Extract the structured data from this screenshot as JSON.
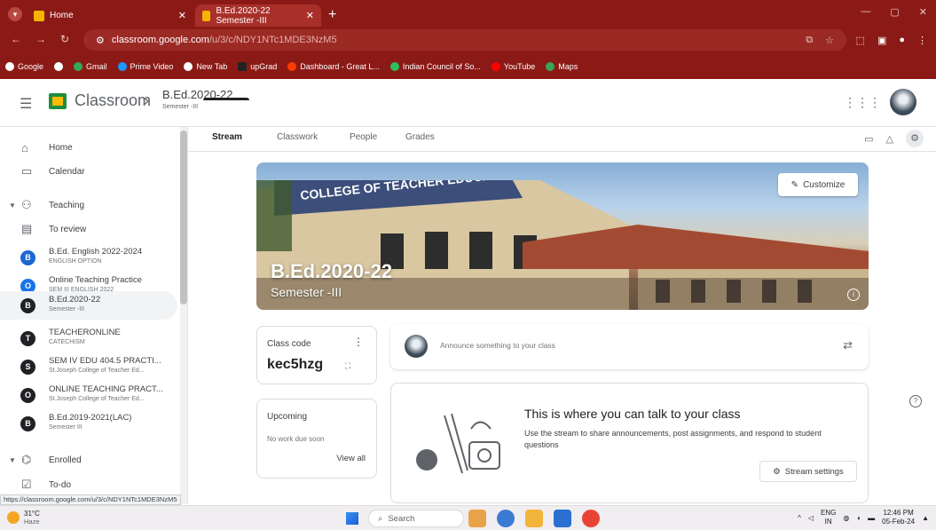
{
  "browser": {
    "tabs": [
      {
        "title": "Home"
      },
      {
        "title": "B.Ed.2020-22 Semester -III"
      }
    ],
    "url_host": "classroom.google.com",
    "url_path": "/u/3/c/NDY1NTc1MDE3NzM5",
    "bookmarks": [
      "Google",
      "Gmail",
      "Prime Video",
      "New Tab",
      "upGrad",
      "Dashboard - Great L...",
      "Indian Council of So...",
      "YouTube",
      "Maps"
    ],
    "status_url": "https://classroom.google.com/u/3/c/NDY1NTc1MDE3NzM5"
  },
  "appbar": {
    "brand": "Classroom",
    "class_title": "B.Ed.2020-22",
    "class_section": "Semester -III"
  },
  "sidebar": {
    "home": "Home",
    "calendar": "Calendar",
    "teaching": "Teaching",
    "to_review": "To review",
    "classes": [
      {
        "initial": "B",
        "name": "B.Ed. English 2022-2024",
        "sub": "ENGLISH OPTION",
        "color": "#1967d2"
      },
      {
        "initial": "O",
        "name": "Online Teaching Practice",
        "sub": "SEM III ENGLISH 2022",
        "color": "#1a73e8"
      },
      {
        "initial": "B",
        "name": "B.Ed.2020-22",
        "sub": "Semester -III",
        "color": "#202124"
      },
      {
        "initial": "T",
        "name": "TEACHERONLINE",
        "sub": "CATECHISM",
        "color": "#202124"
      },
      {
        "initial": "S",
        "name": "SEM IV EDU 404.5 PRACTI...",
        "sub": "St.Joseph College of Teacher Ed...",
        "color": "#202124"
      },
      {
        "initial": "O",
        "name": "ONLINE TEACHING PRACT...",
        "sub": "St.Joseph College of Teacher Ed...",
        "color": "#202124"
      },
      {
        "initial": "B",
        "name": "B.Ed.2019-2021(LAC)",
        "sub": "Semester III",
        "color": "#202124"
      }
    ],
    "enrolled": "Enrolled",
    "todo": "To-do"
  },
  "tabs": [
    "Stream",
    "Classwork",
    "People",
    "Grades"
  ],
  "banner": {
    "sign_text": "COLLEGE OF TEACHER EDUCATION",
    "title": "B.Ed.2020-22",
    "subtitle": "Semester -III",
    "customize": "Customize"
  },
  "class_code": {
    "label": "Class code",
    "code": "kec5hzg"
  },
  "upcoming": {
    "label": "Upcoming",
    "empty": "No work due soon",
    "view_all": "View all"
  },
  "announce": {
    "placeholder": "Announce something to your class"
  },
  "talk": {
    "heading": "This is where you can talk to your class",
    "desc": "Use the stream to share announcements, post assignments, and respond to student questions",
    "settings": "Stream settings"
  },
  "taskbar": {
    "temp": "31°C",
    "weather": "Haze",
    "search": "Search",
    "lang1": "ENG",
    "lang2": "IN",
    "time": "12:46 PM",
    "date": "05-Feb-24"
  },
  "colors": {
    "chrome": "#8b1a17",
    "classroom_green": "#1e8e3e"
  }
}
